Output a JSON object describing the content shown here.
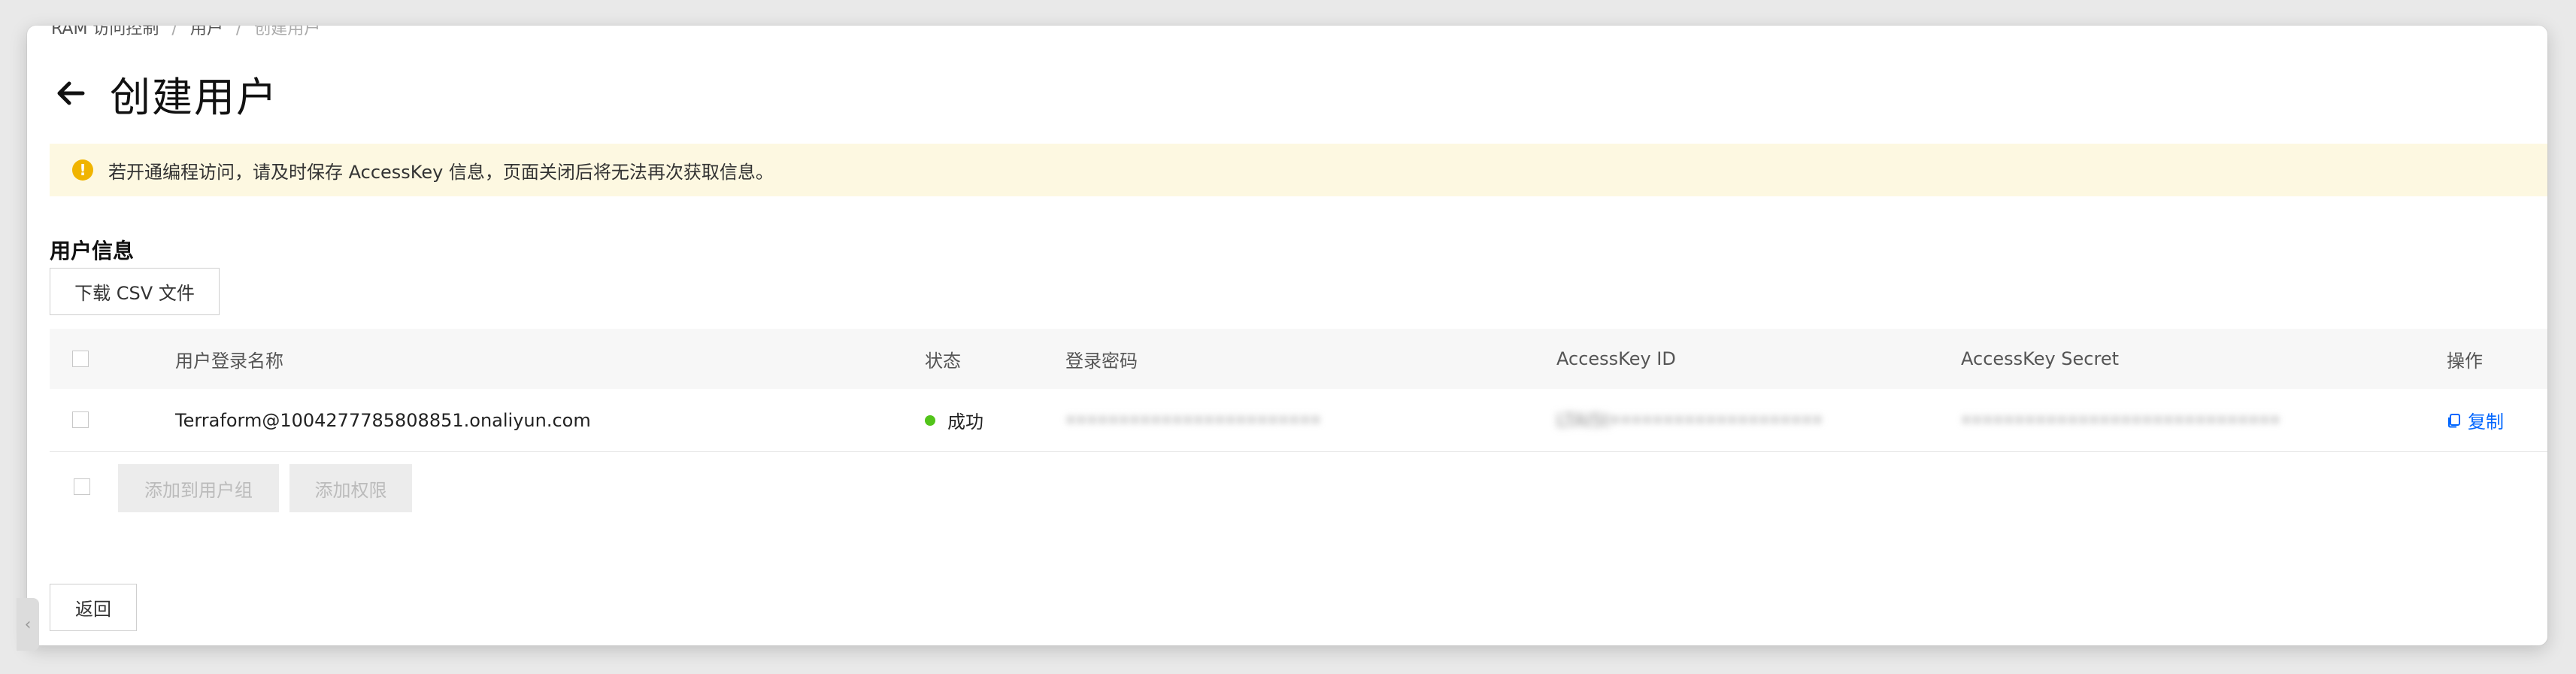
{
  "breadcrumb": {
    "items": [
      "RAM 访问控制",
      "用户",
      "创建用户"
    ],
    "separator": "/"
  },
  "page": {
    "title": "创建用户"
  },
  "alert": {
    "text": "若开通编程访问，请及时保存 AccessKey 信息，页面关闭后将无法再次获取信息。",
    "icon": "warning-icon",
    "color": "#f0b400"
  },
  "section": {
    "title": "用户信息"
  },
  "toolbar": {
    "download_label": "下载 CSV 文件"
  },
  "table": {
    "columns": [
      "用户登录名称",
      "状态",
      "登录密码",
      "AccessKey ID",
      "AccessKey Secret",
      "操作"
    ],
    "rows": [
      {
        "login_name": "Terraform@1004277785808851.onaliyun.com",
        "status": "成功",
        "status_color": "#52c41a",
        "password": "••••••••••••••••••••••••",
        "access_key_id": "LTAI5t••••••••••••••••••••",
        "access_key_secret": "••••••••••••••••••••••••••••••",
        "action": "复制"
      }
    ]
  },
  "batch_actions": {
    "add_to_group": "添加到用户组",
    "add_permission": "添加权限"
  },
  "footer": {
    "return_label": "返回"
  },
  "colors": {
    "accent": "#0066ff",
    "alert_bg": "#fdf8e1",
    "success": "#52c41a"
  }
}
